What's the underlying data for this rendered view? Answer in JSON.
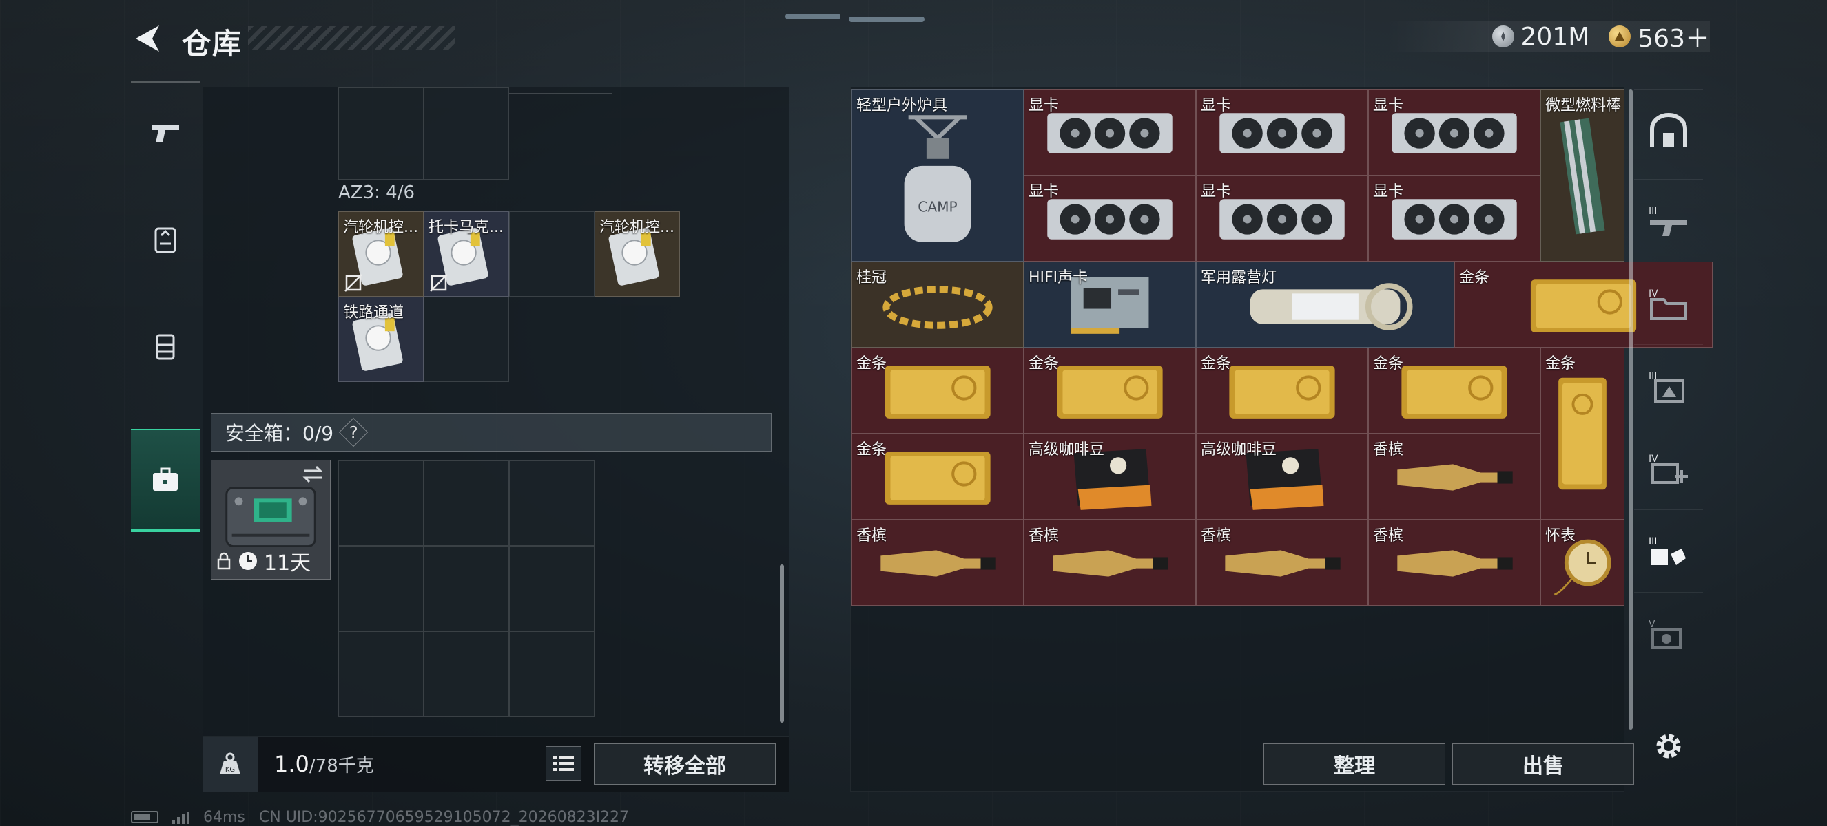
{
  "header": {
    "title": "仓库",
    "currency": [
      {
        "icon": "silver-coin-icon",
        "value": "201M"
      },
      {
        "icon": "gold-coin-icon",
        "value": "563＋"
      }
    ]
  },
  "left_panel": {
    "container_label": "AZ3: 4/6",
    "items": [
      {
        "label": "汽轮机控...",
        "bg": "tan",
        "marked": true
      },
      {
        "label": "托卡马克...",
        "bg": "navy",
        "marked": true
      },
      {
        "label": "汽轮机控...",
        "bg": "tan",
        "marked": false
      },
      {
        "label": "铁路通道",
        "bg": "navy",
        "marked": false
      }
    ],
    "safe_box": {
      "label": "安全箱：0/9",
      "help": "?",
      "duration": "11天"
    },
    "weight": {
      "current": "1.0",
      "max": "/78千克"
    },
    "transfer_all_label": "转移全部"
  },
  "stash": {
    "items": [
      {
        "label": "轻型户外炉具",
        "bg": "navy",
        "art": "stove"
      },
      {
        "label": "显卡",
        "bg": "red",
        "art": "gpu"
      },
      {
        "label": "显卡",
        "bg": "red",
        "art": "gpu"
      },
      {
        "label": "显卡",
        "bg": "red",
        "art": "gpu"
      },
      {
        "label": "微型燃料棒",
        "bg": "olive",
        "art": "fuel"
      },
      {
        "label": "显卡",
        "bg": "red",
        "art": "gpu"
      },
      {
        "label": "显卡",
        "bg": "red",
        "art": "gpu"
      },
      {
        "label": "显卡",
        "bg": "red",
        "art": "gpu"
      },
      {
        "label": "桂冠",
        "bg": "olive",
        "art": "laurel"
      },
      {
        "label": "HIFI声卡",
        "bg": "navy",
        "art": "soundcard"
      },
      {
        "label": "军用露营灯",
        "bg": "navy",
        "art": "lantern"
      },
      {
        "label": "金条",
        "bg": "red",
        "art": "gold"
      },
      {
        "label": "金条",
        "bg": "red",
        "art": "gold"
      },
      {
        "label": "金条",
        "bg": "red",
        "art": "gold"
      },
      {
        "label": "金条",
        "bg": "red",
        "art": "gold"
      },
      {
        "label": "金条",
        "bg": "red",
        "art": "gold"
      },
      {
        "label": "金条",
        "bg": "red",
        "art": "gold-v"
      },
      {
        "label": "金条",
        "bg": "red",
        "art": "gold"
      },
      {
        "label": "高级咖啡豆",
        "bg": "red",
        "art": "coffee"
      },
      {
        "label": "高级咖啡豆",
        "bg": "red",
        "art": "coffee"
      },
      {
        "label": "香槟",
        "bg": "red",
        "art": "champagne"
      },
      {
        "label": "香槟",
        "bg": "red",
        "art": "champagne"
      },
      {
        "label": "香槟",
        "bg": "red",
        "art": "champagne"
      },
      {
        "label": "香槟",
        "bg": "red",
        "art": "champagne"
      },
      {
        "label": "香槟",
        "bg": "red",
        "art": "champagne"
      },
      {
        "label": "怀表",
        "bg": "red",
        "art": "watch"
      }
    ],
    "sort_label": "整理",
    "sell_label": "出售"
  },
  "left_tabs": [
    "weapon-tab",
    "backpack-tab",
    "vest-tab",
    "safe-case-tab"
  ],
  "right_tabs": [
    "tab-home",
    "tab-iii-weapons",
    "tab-iv-folder",
    "tab-iii-gear",
    "tab-iv-add",
    "tab-iii-hands",
    "tab-v-special"
  ],
  "status": {
    "ping": "64ms",
    "uid": "CN UID:90256770659529105072_20260823I227"
  },
  "colors": {
    "accent": "#39d2a0",
    "item_red": "#4a1f25",
    "item_navy": "#243041",
    "item_olive": "#3b3227"
  }
}
